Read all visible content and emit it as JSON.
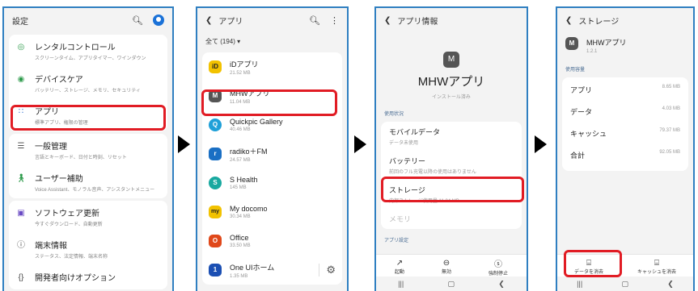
{
  "screen1": {
    "title": "設定",
    "items": [
      {
        "title": "レンタルコントロール",
        "sub": "スクリーンタイム、アプリタイマー、ワインダウン"
      },
      {
        "title": "デバイスケア",
        "sub": "バッテリー、ストレージ、メモリ、セキュリティ"
      },
      {
        "title": "アプリ",
        "sub": "標準アプリ、権限の管理"
      },
      {
        "title": "一般管理",
        "sub": "言語とキーボード、日付と時刻、リセット"
      },
      {
        "title": "ユーザー補助",
        "sub": "Voice Assistant、モノラル音声、アシスタントメニュー"
      },
      {
        "title": "ソフトウェア更新",
        "sub": "今すぐダウンロード、自動更新"
      },
      {
        "title": "端末情報",
        "sub": "ステータス、法定情報、端末名称"
      },
      {
        "title": "開発者向けオプション",
        "sub": ""
      }
    ]
  },
  "screen2": {
    "title": "アプリ",
    "filter": "全て (194)",
    "apps": [
      {
        "name": "iDアプリ",
        "size": "21.52 MB",
        "icon": "iD"
      },
      {
        "name": "MHWアプリ",
        "size": "11.04 MB",
        "icon": "M"
      },
      {
        "name": "Quickpic Gallery",
        "size": "40.46 MB",
        "icon": "Q"
      },
      {
        "name": "radiko＋FM",
        "size": "24.57 MB",
        "icon": "r"
      },
      {
        "name": "S Health",
        "size": "145 MB",
        "icon": "S"
      },
      {
        "name": "My docomo",
        "size": "30.34 MB",
        "icon": "my"
      },
      {
        "name": "Office",
        "size": "33.50 MB",
        "icon": "O"
      },
      {
        "name": "One UIホーム",
        "size": "1.35 MB",
        "icon": "1"
      }
    ]
  },
  "screen3": {
    "title": "アプリ情報",
    "app_name": "MHWアプリ",
    "installed": "インストール済み",
    "section_usage": "使用状況",
    "items": [
      {
        "title": "モバイルデータ",
        "sub": "データ未使用"
      },
      {
        "title": "バッテリー",
        "sub": "前回のフル充電以降の使用はありません"
      },
      {
        "title": "ストレージ",
        "sub": "内部ストレージ使用量 11.04 MB"
      },
      {
        "title": "メモリ",
        "sub": ""
      }
    ],
    "section_settings": "アプリ設定",
    "bottom": {
      "open": "起動",
      "uninstall": "無効",
      "force_stop": "強制停止"
    }
  },
  "screen4": {
    "title": "ストレージ",
    "app_name": "MHWアプリ",
    "version": "1.2.1",
    "section": "使用容量",
    "rows": [
      {
        "label": "アプリ",
        "value": "8.65 MB"
      },
      {
        "label": "データ",
        "value": "4.03 MB"
      },
      {
        "label": "キャッシュ",
        "value": "79.37 MB"
      },
      {
        "label": "合計",
        "value": "92.05 MB"
      }
    ],
    "clear_data": "データを消去",
    "clear_cache": "キャッシュを消去"
  }
}
